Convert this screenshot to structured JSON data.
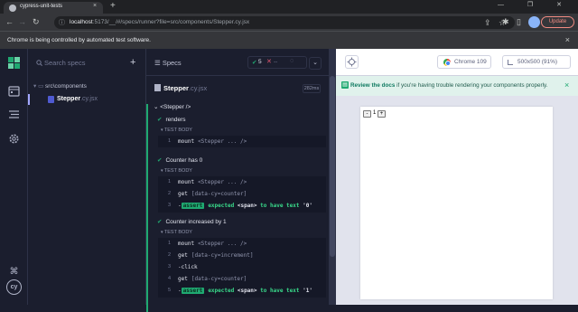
{
  "browser": {
    "tab_title": "cypress-unit-tests",
    "tab_close": "×",
    "new_tab": "+",
    "window_controls": "—  ❐  ✕",
    "url_host": "localhost",
    "url_rest": ":5173/__/#/specs/runner?file=src/components/Stepper.cy.jsx",
    "update_label": "Update",
    "infobar_text": "Chrome is being controlled by automated test software.",
    "infobar_close": "×"
  },
  "specs_panel": {
    "search_placeholder": "Search specs",
    "add_label": "+",
    "folder": "src\\components",
    "spec_name": "Stepper",
    "spec_ext": ".cy.jsx"
  },
  "reporter": {
    "header_label": "Specs",
    "passed": "5",
    "failed": "--",
    "pending": "--",
    "file_name": "Stepper",
    "file_ext": ".cy.jsx",
    "duration": "282ms",
    "suite_title": "<Stepper />",
    "test_body_label": "TEST BODY",
    "tests": [
      {
        "title": "renders",
        "commands": [
          {
            "num": "1",
            "name": "mount",
            "msg": "<Stepper ... />"
          }
        ]
      },
      {
        "title": "Counter has 0",
        "commands": [
          {
            "num": "1",
            "name": "mount",
            "msg": "<Stepper ... />"
          },
          {
            "num": "2",
            "name": "get",
            "msg": "[data-cy=counter]"
          },
          {
            "num": "3",
            "badge": "assert",
            "text_a": "expected",
            "text_b": "<span>",
            "text_c": "to have text",
            "text_d": "'0'"
          }
        ]
      },
      {
        "title": "Counter increased by 1",
        "commands": [
          {
            "num": "1",
            "name": "mount",
            "msg": "<Stepper ... />"
          },
          {
            "num": "2",
            "name": "get",
            "msg": "[data-cy=increment]"
          },
          {
            "num": "3",
            "name": "-click",
            "msg": ""
          },
          {
            "num": "4",
            "name": "get",
            "msg": "[data-cy=counter]"
          },
          {
            "num": "5",
            "badge": "assert",
            "text_a": "expected",
            "text_b": "<span>",
            "text_c": "to have text",
            "text_d": "'1'"
          }
        ]
      }
    ]
  },
  "aut": {
    "browser_name": "Chrome 109",
    "viewport": "500x500 (91%)",
    "docs_link": "Review the docs",
    "docs_text": " if you're having trouble rendering your components properly.",
    "docs_close": "×",
    "stepper": {
      "decrement": "-",
      "count": "1",
      "increment": "+"
    }
  },
  "colors": {
    "pass": "#1fa971",
    "fail": "#e45770",
    "accent": "#a3a8ff",
    "sidebar_bg": "#1b1e2e"
  }
}
